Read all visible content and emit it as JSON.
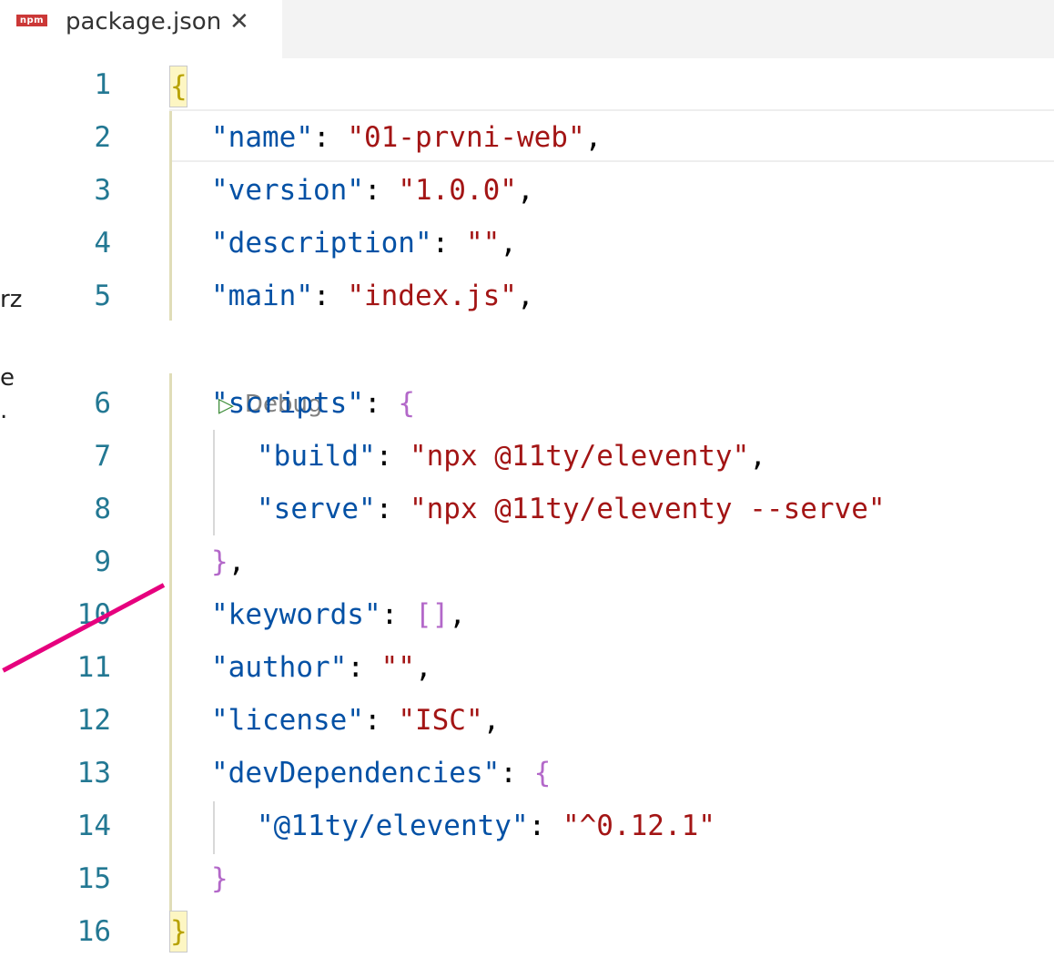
{
  "tab": {
    "icon_text": "npm",
    "title": "package.json",
    "close_glyph": "✕"
  },
  "sidebar_fragments": [
    "rz",
    "e",
    "."
  ],
  "codelens": {
    "label": "Debug"
  },
  "lines": [
    {
      "n": "1"
    },
    {
      "n": "2",
      "key": "\"name\"",
      "value": "\"01-prvni-web\"",
      "tail": ","
    },
    {
      "n": "3",
      "key": "\"version\"",
      "value": "\"1.0.0\"",
      "tail": ","
    },
    {
      "n": "4",
      "key": "\"description\"",
      "value": "\"\"",
      "tail": ","
    },
    {
      "n": "5",
      "key": "\"main\"",
      "value": "\"index.js\"",
      "tail": ","
    },
    {
      "n": "6",
      "key": "\"scripts\"",
      "open": "{"
    },
    {
      "n": "7",
      "key": "\"build\"",
      "value": "\"npx @11ty/eleventy\"",
      "tail": ","
    },
    {
      "n": "8",
      "key": "\"serve\"",
      "value": "\"npx @11ty/eleventy --serve\""
    },
    {
      "n": "9",
      "close": "}",
      "tail": ","
    },
    {
      "n": "10",
      "key": "\"keywords\"",
      "open": "[]",
      "tail": ","
    },
    {
      "n": "11",
      "key": "\"author\"",
      "value": "\"\"",
      "tail": ","
    },
    {
      "n": "12",
      "key": "\"license\"",
      "value": "\"ISC\"",
      "tail": ","
    },
    {
      "n": "13",
      "key": "\"devDependencies\"",
      "open": "{"
    },
    {
      "n": "14",
      "key": "\"@11ty/eleventy\"",
      "value": "\"^0.12.1\""
    },
    {
      "n": "15",
      "close": "}"
    },
    {
      "n": "16"
    }
  ],
  "outer_brace_open": "{",
  "outer_brace_close": "}",
  "colors": {
    "key": "#0451a5",
    "string": "#a31515",
    "line_number": "#237893",
    "bracket": "#b368c9",
    "annotation": "#e6007e",
    "npm": "#cb3837"
  },
  "icons": [
    "npm-icon",
    "close-icon",
    "debug-run-icon"
  ]
}
